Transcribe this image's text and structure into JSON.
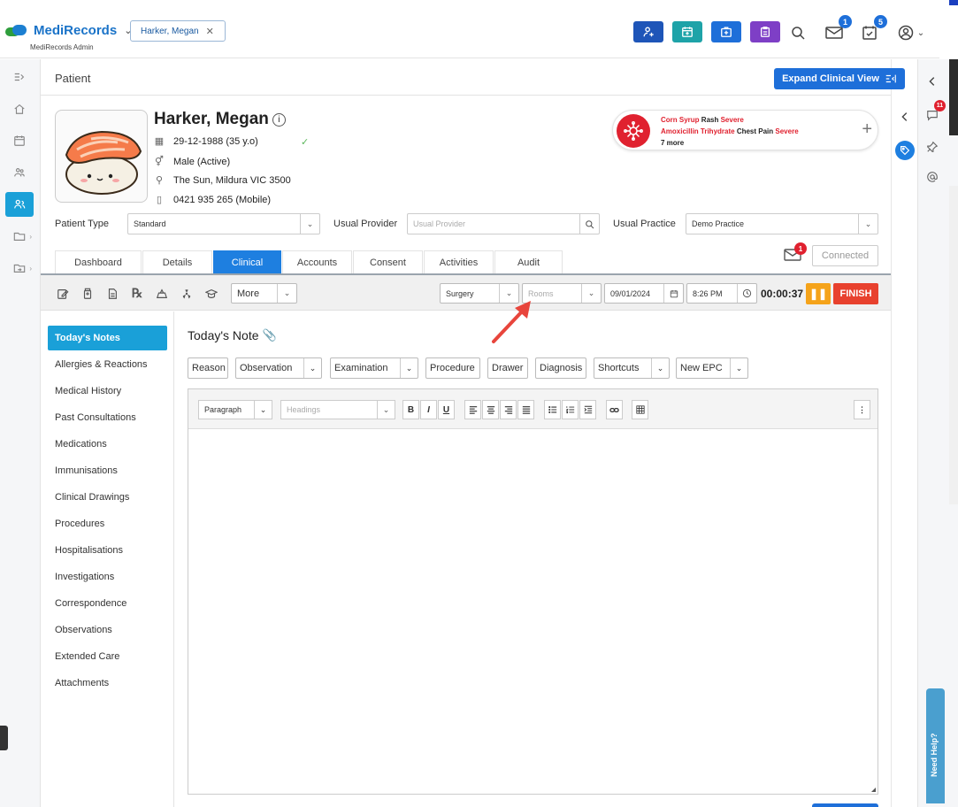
{
  "header": {
    "brand": "MediRecords",
    "brand_sub": "MediRecords Admin",
    "patient_chip": "Harker, Megan",
    "mail_badge": "1",
    "tasks_badge": "5"
  },
  "page": {
    "title": "Patient",
    "expand_button": "Expand Clinical View"
  },
  "patient": {
    "name": "Harker, Megan",
    "dob": "29-12-1988 (35 y.o)",
    "gender": "Male (Active)",
    "address": "The Sun, Mildura VIC 3500",
    "phone": "0421 935 265 (Mobile)"
  },
  "allergies": {
    "items": [
      {
        "substance": "Corn Syrup",
        "reaction": "Rash",
        "severity": "Severe"
      },
      {
        "substance": "Amoxicillin Trihydrate",
        "reaction": "Chest Pain",
        "severity": "Severe"
      }
    ],
    "more": "7 more"
  },
  "fields": {
    "patient_type_label": "Patient Type",
    "patient_type_value": "Standard",
    "usual_provider_label": "Usual Provider",
    "usual_provider_placeholder": "Usual Provider",
    "usual_practice_label": "Usual Practice",
    "usual_practice_value": "Demo Practice"
  },
  "tabs": [
    "Dashboard",
    "Details",
    "Clinical",
    "Accounts",
    "Consent",
    "Activities",
    "Audit"
  ],
  "active_tab": "Clinical",
  "connection": {
    "mail_badge": "1",
    "status": "Connected"
  },
  "toolbar": {
    "more": "More",
    "location": "Surgery",
    "rooms_placeholder": "Rooms",
    "date": "09/01/2024",
    "time": "8:26 PM",
    "timer": "00:00:37",
    "finish": "FINISH"
  },
  "sidenav": [
    "Today's Notes",
    "Allergies & Reactions",
    "Medical History",
    "Past Consultations",
    "Medications",
    "Immunisations",
    "Clinical Drawings",
    "Procedures",
    "Hospitalisations",
    "Investigations",
    "Correspondence",
    "Observations",
    "Extended Care",
    "Attachments"
  ],
  "note": {
    "title": "Today's Note",
    "buttons": {
      "reason": "Reason",
      "observation": "Observation",
      "examination": "Examination",
      "procedure": "Procedure",
      "drawer": "Drawer",
      "diagnosis": "Diagnosis",
      "shortcuts": "Shortcuts",
      "new_epc": "New EPC"
    }
  },
  "editor": {
    "block_format": "Paragraph",
    "headings_placeholder": "Headings"
  },
  "rightrail": {
    "chat_badge": "11",
    "need_help": "Need Help?"
  },
  "colors": {
    "primary": "#1e6fd9",
    "accent_teal": "#1aa0d8",
    "danger": "#e0212f",
    "warning": "#f5a31a"
  }
}
